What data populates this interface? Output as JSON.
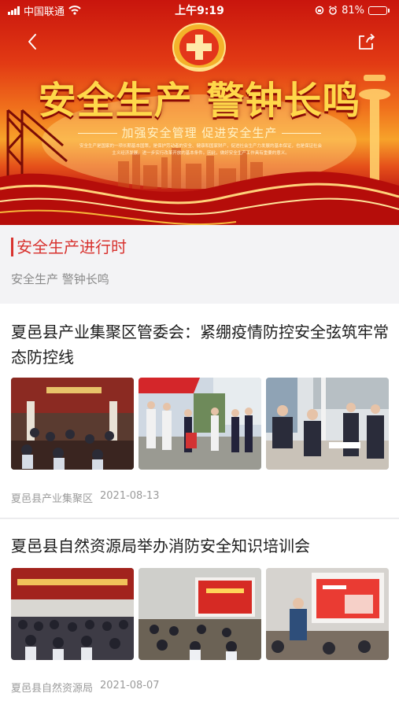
{
  "status_bar": {
    "carrier": "中国联通",
    "time": "上午9:19",
    "battery_percent": "81%",
    "battery_level": 0.81
  },
  "banner": {
    "title": "安全生产 警钟长鸣",
    "slogan": "加强安全管理 促进安全生产",
    "body_text": "安全生产是国家的一项长期基本国策，是保护劳动者的安全、健康和国家财产，促进社会生产力发展的基本保证，也是保证社会主义经济发展，进一步实行改革开放的基本条件。因此，做好安全生产工作具有重要的意义。",
    "colors": {
      "red": "#c9150d",
      "gold": "#ffd84a"
    }
  },
  "section": {
    "title": "安全生产进行时",
    "subtitle": "安全生产  警钟长鸣",
    "accent_color": "#d8322e"
  },
  "articles": [
    {
      "title": "夏邑县产业集聚区管委会：紧绷疫情防控安全弦筑牢常态防控线",
      "source": "夏邑县产业集聚区",
      "date": "2021-08-13",
      "thumbnails": [
        "meeting-room-photo",
        "outdoor-epidemic-checkpoint-photo",
        "registration-desk-photo"
      ]
    },
    {
      "title": "夏邑县自然资源局举办消防安全知识培训会",
      "source": "夏邑县自然资源局",
      "date": "2021-08-07",
      "thumbnails": [
        "training-hall-photo",
        "projection-lecture-photo",
        "presenter-photo"
      ]
    }
  ]
}
